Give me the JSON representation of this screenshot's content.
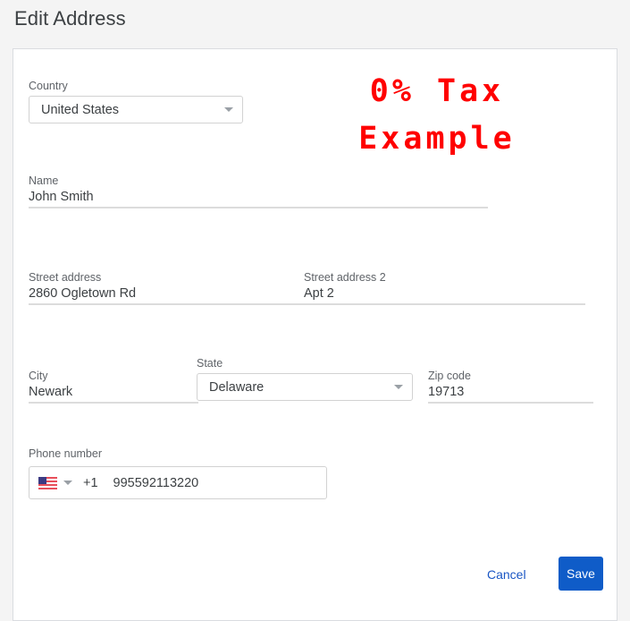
{
  "page": {
    "title": "Edit Address",
    "background_color": "#f4f4f4"
  },
  "overlay": {
    "line1": "0% Tax",
    "line2": "Example",
    "color": "#ff0000"
  },
  "form": {
    "country": {
      "label": "Country",
      "value": "United States",
      "caret_icon": "chevron-down-icon"
    },
    "name": {
      "label": "Name",
      "value": "John Smith",
      "placeholder": ""
    },
    "street_address": {
      "label": "Street address",
      "value": "2860 Ogletown Rd",
      "placeholder": ""
    },
    "street_address_2": {
      "label": "Street address 2",
      "value": "Apt 2",
      "placeholder": ""
    },
    "city": {
      "label": "City",
      "value": "Newark",
      "placeholder": ""
    },
    "state": {
      "label": "State",
      "value": "Delaware",
      "caret_icon": "chevron-down-icon"
    },
    "zip_code": {
      "label": "Zip code",
      "value": "19713",
      "placeholder": ""
    },
    "phone": {
      "label": "Phone number",
      "flag_icon": "us-flag-icon",
      "caret_icon": "chevron-down-icon",
      "dial_code": "+1",
      "value": "995592113220",
      "placeholder": ""
    }
  },
  "actions": {
    "cancel_label": "Cancel",
    "save_label": "Save",
    "save_color": "#0f5cc8",
    "cancel_color": "#1a56c4"
  }
}
